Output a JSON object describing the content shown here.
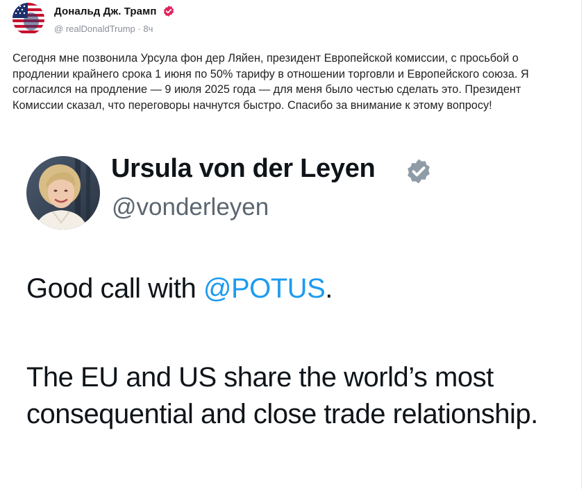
{
  "post": {
    "author_name": "Дональд Дж. Трамп",
    "handle_prefix": "@",
    "handle": "realDonaldTrump",
    "separator": "·",
    "time_ago": "8ч",
    "text": "Сегодня мне позвонила Урсула фон дер Ляйен, президент Европейской комиссии, с просьбой о продлении крайнего срока 1 июня по 50% тарифу в отношении торговли и Европейского союза. Я согласился на продление — 9 июля 2025 года — для меня было честью сделать это. Президент Комиссии сказал, что переговоры начнутся быстро. Спасибо за внимание к этому вопросу!"
  },
  "embed": {
    "name": "Ursula von der Leyen",
    "handle": "@vonderleyen",
    "line1_prefix": "Good call with ",
    "line1_mention": "@POTUS",
    "line1_suffix": ".",
    "paragraph2": "The EU and US share the world’s most consequential and close trade relationship."
  },
  "icons": {
    "author_avatar": "american-flag-avatar",
    "author_verified": "verified-badge-icon",
    "embed_verified": "verified-badge-icon"
  },
  "colors": {
    "author_verified_badge": "#e0245e",
    "embed_verified_badge": "#8f9ba6",
    "mention": "#1d9bf0",
    "handle": "#8a8f98"
  }
}
